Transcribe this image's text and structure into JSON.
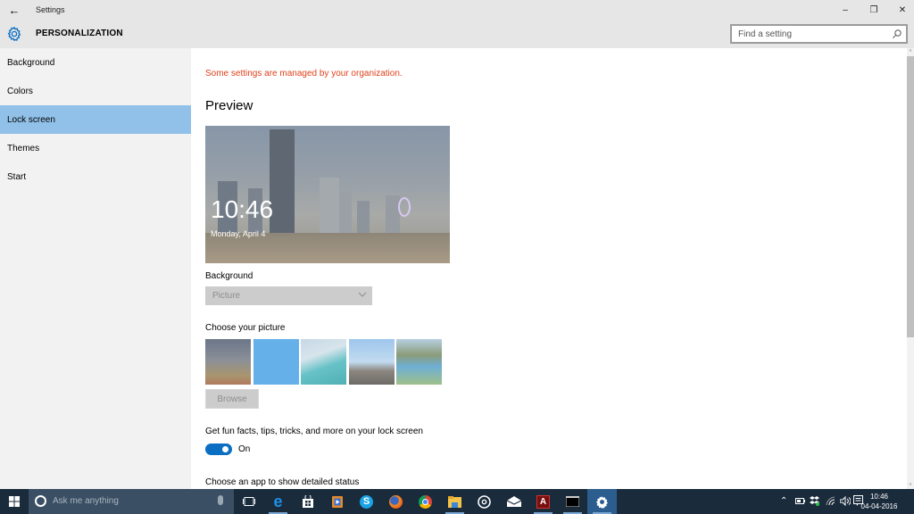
{
  "window": {
    "app_title": "Settings",
    "back_icon": "arrow-left-icon",
    "controls": {
      "minimize": "–",
      "maximize": "❐",
      "close": "✕"
    }
  },
  "header": {
    "title": "PERSONALIZATION",
    "icon": "gear-icon",
    "search_placeholder": "Find a setting"
  },
  "sidebar": {
    "items": [
      {
        "label": "Background",
        "active": false
      },
      {
        "label": "Colors",
        "active": false
      },
      {
        "label": "Lock screen",
        "active": true
      },
      {
        "label": "Themes",
        "active": false
      },
      {
        "label": "Start",
        "active": false
      }
    ]
  },
  "main": {
    "managed_notice": "Some settings are managed by your organization.",
    "preview_heading": "Preview",
    "preview": {
      "time": "10:46",
      "date": "Monday, April 4"
    },
    "background_label": "Background",
    "background_select": {
      "value": "Picture",
      "disabled": true
    },
    "choose_picture_label": "Choose your picture",
    "thumbnails": [
      {
        "name": "city-night"
      },
      {
        "name": "solid-blue"
      },
      {
        "name": "ocean-wing"
      },
      {
        "name": "mountain-sky"
      },
      {
        "name": "lake-valley"
      }
    ],
    "browse_label": "Browse",
    "fun_facts_label": "Get fun facts, tips, tricks, and more on your lock screen",
    "fun_facts_toggle": {
      "on": true,
      "state_label": "On"
    },
    "detailed_status_label": "Choose an app to show detailed status"
  },
  "colors": {
    "accent": "#0a6fc2",
    "sidebar_active": "#91c1e8",
    "warning_text": "#e0401a",
    "taskbar": "#1a2b3c"
  },
  "taskbar": {
    "search_placeholder": "Ask me anything",
    "apps": [
      {
        "name": "task-view",
        "icon": "task-view-icon"
      },
      {
        "name": "edge",
        "icon": "edge-icon",
        "running": true
      },
      {
        "name": "store",
        "icon": "store-icon"
      },
      {
        "name": "media-player",
        "icon": "media-player-icon"
      },
      {
        "name": "skype",
        "icon": "skype-icon"
      },
      {
        "name": "firefox",
        "icon": "firefox-icon"
      },
      {
        "name": "chrome",
        "icon": "chrome-icon"
      },
      {
        "name": "file-explorer",
        "icon": "folder-icon",
        "running": true
      },
      {
        "name": "groove",
        "icon": "groove-icon"
      },
      {
        "name": "mail",
        "icon": "mail-icon"
      },
      {
        "name": "acrobat",
        "icon": "pdf-icon",
        "running": true
      },
      {
        "name": "command-prompt",
        "icon": "terminal-icon",
        "running": true
      },
      {
        "name": "settings",
        "icon": "gear-icon",
        "active": true
      }
    ],
    "tray": {
      "icons": [
        "chevron-up-icon",
        "battery-icon",
        "dropbox-icon",
        "wifi-icon",
        "volume-icon",
        "notifications-icon"
      ],
      "time": "10:46",
      "date": "04-04-2016"
    }
  }
}
